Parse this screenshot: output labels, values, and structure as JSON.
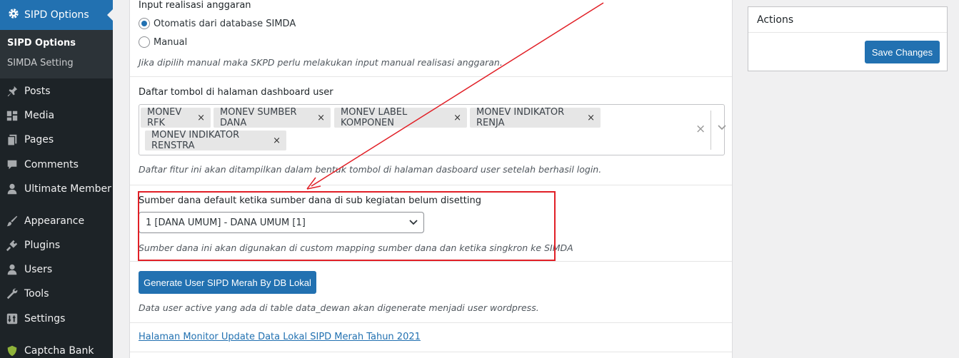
{
  "sidebar": {
    "active_menu": "SIPD Options",
    "submenu": [
      "SIPD Options",
      "SIMDA Setting"
    ],
    "items": [
      {
        "label": "Posts",
        "icon": "pin-icon"
      },
      {
        "label": "Media",
        "icon": "media-icon"
      },
      {
        "label": "Pages",
        "icon": "pages-icon"
      },
      {
        "label": "Comments",
        "icon": "comments-icon"
      },
      {
        "label": "Ultimate Member",
        "icon": "user-icon"
      },
      {
        "label": "Appearance",
        "icon": "brush-icon"
      },
      {
        "label": "Plugins",
        "icon": "plugin-icon"
      },
      {
        "label": "Users",
        "icon": "users-icon"
      },
      {
        "label": "Tools",
        "icon": "wrench-icon"
      },
      {
        "label": "Settings",
        "icon": "settings-icon"
      },
      {
        "label": "Captcha Bank",
        "icon": "shield-icon"
      }
    ]
  },
  "form": {
    "realisasi": {
      "title": "Input realisasi anggaran",
      "options": [
        "Otomatis dari database SIMDA",
        "Manual"
      ],
      "selected": "Otomatis dari database SIMDA",
      "description": "Jika dipilih manual maka SKPD perlu melakukan input manual realisasi anggaran."
    },
    "tombol": {
      "title": "Daftar tombol di halaman dashboard user",
      "tags": [
        "MONEV RFK",
        "MONEV SUMBER DANA",
        "MONEV LABEL KOMPONEN",
        "MONEV INDIKATOR RENJA",
        "MONEV INDIKATOR RENSTRA"
      ],
      "remove_glyph": "×",
      "clear_glyph": "×",
      "description": "Daftar fitur ini akan ditampilkan dalam bentuk tombol di halaman dasboard user setelah berhasil login."
    },
    "sumber_dana": {
      "title": "Sumber dana default ketika sumber dana di sub kegiatan belum disetting",
      "selected": "1 [DANA UMUM] - DANA UMUM [1]",
      "description": "Sumber dana ini akan digunakan di custom mapping sumber dana dan ketika singkron ke SIMDA"
    },
    "generate": {
      "button": "Generate User SIPD Merah By DB Lokal",
      "description": "Data user active yang ada di table data_dewan akan digenerate menjadi user wordpress."
    },
    "monitor_link": "Halaman Monitor Update Data Lokal SIPD Merah Tahun 2021"
  },
  "actions": {
    "title": "Actions",
    "save_label": "Save Changes"
  },
  "colors": {
    "accent": "#2271b1",
    "sidebar_bg": "#1d2327",
    "annotation": "#e11f26"
  }
}
